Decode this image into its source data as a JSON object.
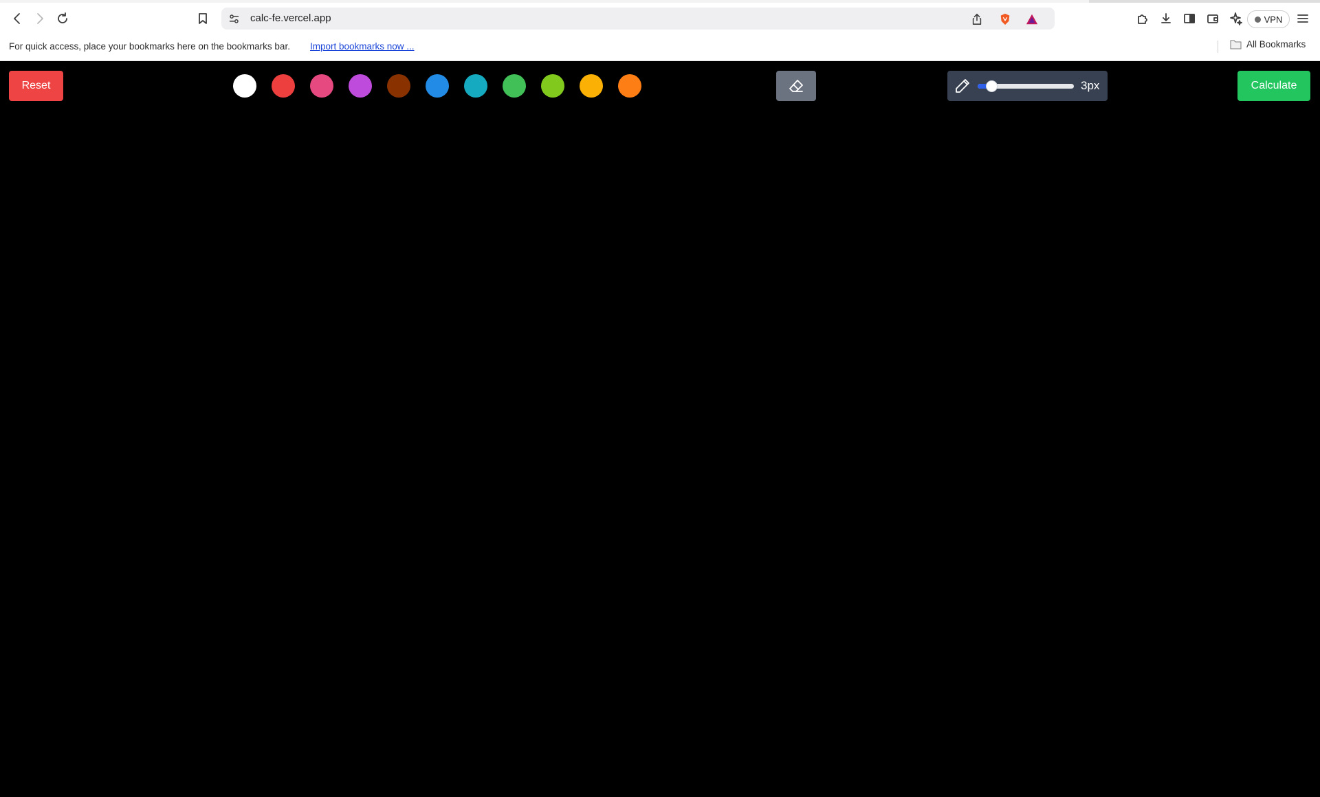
{
  "browser": {
    "url": "calc-fe.vercel.app",
    "vpn_label": "VPN",
    "bookmarks_hint": "For quick access, place your bookmarks here on the bookmarks bar.",
    "import_link": "Import bookmarks now ...",
    "all_bookmarks": "All Bookmarks",
    "icons": [
      "back-icon",
      "forward-icon",
      "reload-icon",
      "bookmark-icon",
      "site-settings-icon",
      "share-icon",
      "brave-shields-icon",
      "brave-rewards-icon",
      "extensions-icon",
      "downloads-icon",
      "sidebar-icon",
      "wallet-icon",
      "leo-ai-icon",
      "menu-icon",
      "folder-icon"
    ]
  },
  "app": {
    "reset_label": "Reset",
    "calculate_label": "Calculate",
    "colors": [
      "#000000",
      "#ffffff",
      "#ee3f3f",
      "#e64980",
      "#be4bdb",
      "#893200",
      "#228be6",
      "#15aabf",
      "#40c057",
      "#82c91e",
      "#fab005",
      "#fd7e14"
    ],
    "brush_size_label": "3px",
    "brush_size_fraction": 0.1,
    "colors_meta": {
      "reset": "#ef4444",
      "calculate": "#22c55e",
      "eraser": "#6b7280",
      "brush_panel": "#374151"
    }
  }
}
